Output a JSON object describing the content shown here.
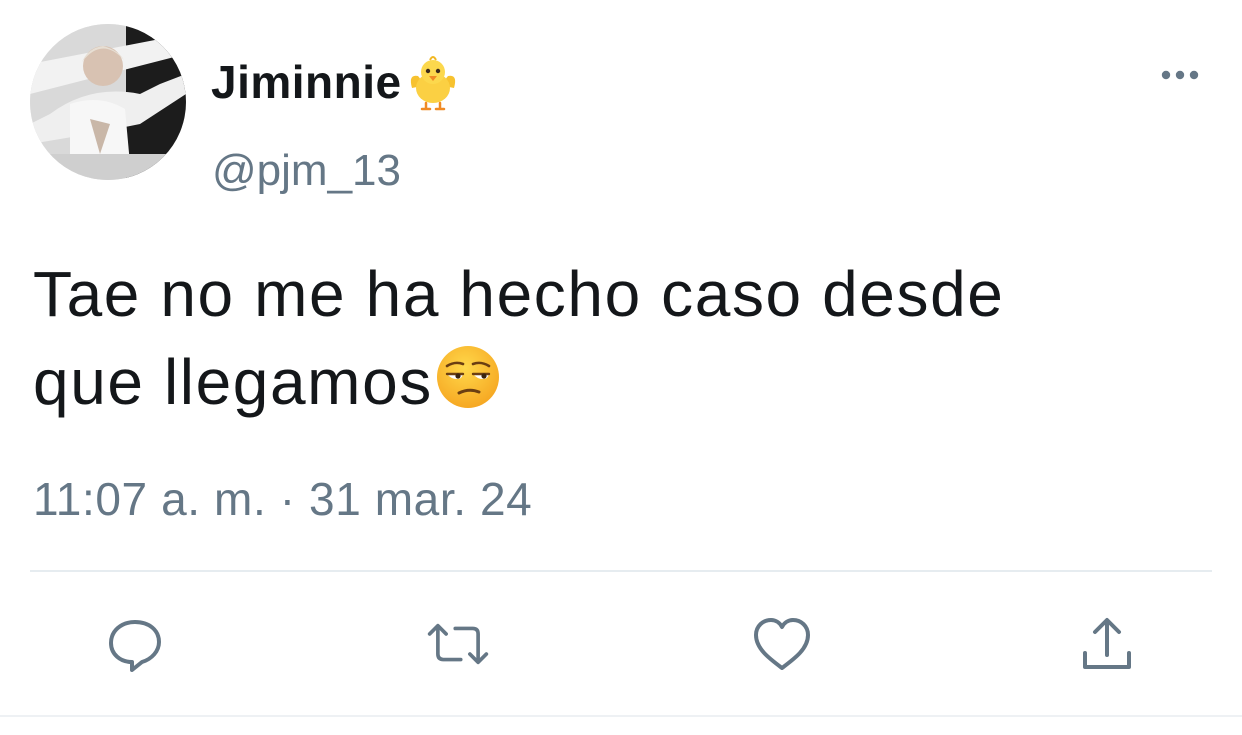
{
  "tweet": {
    "author": {
      "display_name": "Jiminnie",
      "name_emoji": "chick-icon",
      "handle": "@pjm_13"
    },
    "text_line1": "Tae no me ha hecho caso desde",
    "text_line2": "que llegamos",
    "text_emoji": "unamused-face-icon",
    "time": "11:07 a. m.",
    "separator": " · ",
    "date": "31 mar. 24"
  },
  "actions": [
    {
      "icon": "reply-icon"
    },
    {
      "icon": "retweet-icon"
    },
    {
      "icon": "like-icon"
    },
    {
      "icon": "share-icon"
    }
  ],
  "colors": {
    "text_primary": "#14171a",
    "text_secondary": "#657786",
    "icon": "#657786",
    "divider": "#e6ecf0"
  }
}
